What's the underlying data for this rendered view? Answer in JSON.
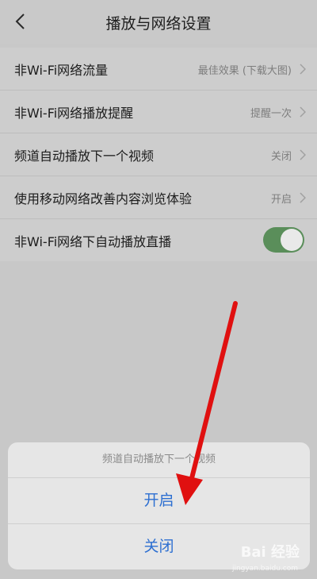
{
  "header": {
    "title": "播放与网络设置",
    "back_icon": "chevron-left-icon"
  },
  "settings": [
    {
      "label": "非Wi-Fi网络流量",
      "value": "最佳效果 (下载大图)"
    },
    {
      "label": "非Wi-Fi网络播放提醒",
      "value": "提醒一次"
    },
    {
      "label": "频道自动播放下一个视频",
      "value": "关闭"
    },
    {
      "label": "使用移动网络改善内容浏览体验",
      "value": "开启"
    },
    {
      "label": "非Wi-Fi网络下自动播放直播",
      "toggle_on": true
    }
  ],
  "sheet": {
    "title": "频道自动播放下一个视频",
    "options": [
      "开启",
      "关闭"
    ]
  },
  "colors": {
    "accent": "#2d6fd1",
    "toggle": "#5a8e5a",
    "arrow": "#e01010"
  },
  "watermark": {
    "text": "Bai 经验",
    "sub": "jingyan.baidu.com"
  }
}
